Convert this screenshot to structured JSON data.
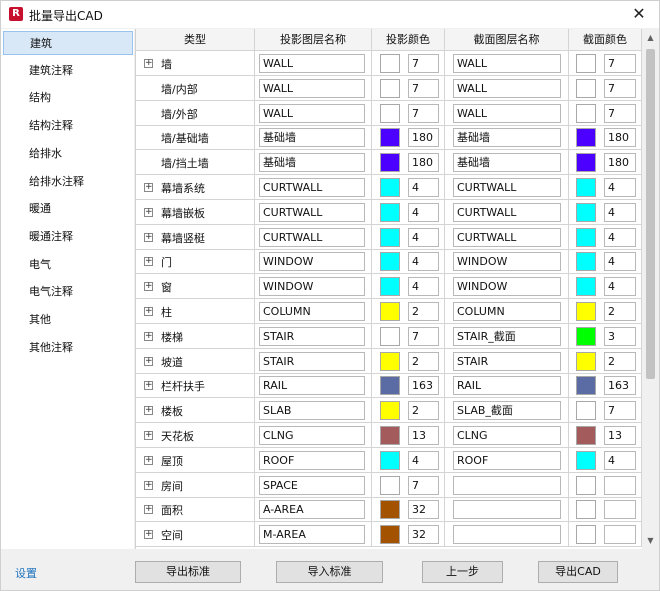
{
  "window": {
    "title": "批量导出CAD",
    "app_icon": "R",
    "close": "✕"
  },
  "sidebar": {
    "items": [
      "建筑",
      "建筑注释",
      "结构",
      "结构注释",
      "给排水",
      "给排水注释",
      "暖通",
      "暖通注释",
      "电气",
      "电气注释",
      "其他",
      "其他注释"
    ],
    "selected": "建筑"
  },
  "table": {
    "headers": [
      "类型",
      "投影图层名称",
      "投影颜色",
      "截面图层名称",
      "截面颜色"
    ],
    "rows": [
      {
        "type": "墙",
        "expandable": true,
        "proj_layer": "WALL",
        "proj_color": "#ffffff",
        "proj_num": "7",
        "cut_layer": "WALL",
        "cut_color": "#ffffff",
        "cut_num": "7"
      },
      {
        "type": "墙/内部",
        "expandable": false,
        "proj_layer": "WALL",
        "proj_color": "#ffffff",
        "proj_num": "7",
        "cut_layer": "WALL",
        "cut_color": "#ffffff",
        "cut_num": "7"
      },
      {
        "type": "墙/外部",
        "expandable": false,
        "proj_layer": "WALL",
        "proj_color": "#ffffff",
        "proj_num": "7",
        "cut_layer": "WALL",
        "cut_color": "#ffffff",
        "cut_num": "7"
      },
      {
        "type": "墙/基础墙",
        "expandable": false,
        "proj_layer": "基础墙",
        "proj_color": "#4c00ff",
        "proj_num": "180",
        "cut_layer": "基础墙",
        "cut_color": "#4c00ff",
        "cut_num": "180"
      },
      {
        "type": "墙/挡土墙",
        "expandable": false,
        "proj_layer": "基础墙",
        "proj_color": "#4c00ff",
        "proj_num": "180",
        "cut_layer": "基础墙",
        "cut_color": "#4c00ff",
        "cut_num": "180"
      },
      {
        "type": "幕墙系统",
        "expandable": true,
        "proj_layer": "CURTWALL",
        "proj_color": "#00ffff",
        "proj_num": "4",
        "cut_layer": "CURTWALL",
        "cut_color": "#00ffff",
        "cut_num": "4"
      },
      {
        "type": "幕墙嵌板",
        "expandable": true,
        "proj_layer": "CURTWALL",
        "proj_color": "#00ffff",
        "proj_num": "4",
        "cut_layer": "CURTWALL",
        "cut_color": "#00ffff",
        "cut_num": "4"
      },
      {
        "type": "幕墙竖梃",
        "expandable": true,
        "proj_layer": "CURTWALL",
        "proj_color": "#00ffff",
        "proj_num": "4",
        "cut_layer": "CURTWALL",
        "cut_color": "#00ffff",
        "cut_num": "4"
      },
      {
        "type": "门",
        "expandable": true,
        "proj_layer": "WINDOW",
        "proj_color": "#00ffff",
        "proj_num": "4",
        "cut_layer": "WINDOW",
        "cut_color": "#00ffff",
        "cut_num": "4"
      },
      {
        "type": "窗",
        "expandable": true,
        "proj_layer": "WINDOW",
        "proj_color": "#00ffff",
        "proj_num": "4",
        "cut_layer": "WINDOW",
        "cut_color": "#00ffff",
        "cut_num": "4"
      },
      {
        "type": "柱",
        "expandable": true,
        "proj_layer": "COLUMN",
        "proj_color": "#ffff00",
        "proj_num": "2",
        "cut_layer": "COLUMN",
        "cut_color": "#ffff00",
        "cut_num": "2"
      },
      {
        "type": "楼梯",
        "expandable": true,
        "proj_layer": "STAIR",
        "proj_color": "#ffffff",
        "proj_num": "7",
        "cut_layer": "STAIR_截面",
        "cut_color": "#00ff00",
        "cut_num": "3"
      },
      {
        "type": "坡道",
        "expandable": true,
        "proj_layer": "STAIR",
        "proj_color": "#ffff00",
        "proj_num": "2",
        "cut_layer": "STAIR",
        "cut_color": "#ffff00",
        "cut_num": "2"
      },
      {
        "type": "栏杆扶手",
        "expandable": true,
        "proj_layer": "RAIL",
        "proj_color": "#5b6ba3",
        "proj_num": "163",
        "cut_layer": "RAIL",
        "cut_color": "#5b6ba3",
        "cut_num": "163"
      },
      {
        "type": "楼板",
        "expandable": true,
        "proj_layer": "SLAB",
        "proj_color": "#ffff00",
        "proj_num": "2",
        "cut_layer": "SLAB_截面",
        "cut_color": "#ffffff",
        "cut_num": "7"
      },
      {
        "type": "天花板",
        "expandable": true,
        "proj_layer": "CLNG",
        "proj_color": "#a35b5b",
        "proj_num": "13",
        "cut_layer": "CLNG",
        "cut_color": "#a35b5b",
        "cut_num": "13"
      },
      {
        "type": "屋顶",
        "expandable": true,
        "proj_layer": "ROOF",
        "proj_color": "#00ffff",
        "proj_num": "4",
        "cut_layer": "ROOF",
        "cut_color": "#00ffff",
        "cut_num": "4"
      },
      {
        "type": "房间",
        "expandable": true,
        "proj_layer": "SPACE",
        "proj_color": "#ffffff",
        "proj_num": "7",
        "cut_layer": "",
        "cut_color": "#ffffff",
        "cut_num": ""
      },
      {
        "type": "面积",
        "expandable": true,
        "proj_layer": "A-AREA",
        "proj_color": "#a35200",
        "proj_num": "32",
        "cut_layer": "",
        "cut_color": "#ffffff",
        "cut_num": ""
      },
      {
        "type": "空间",
        "expandable": true,
        "proj_layer": "M-AREA",
        "proj_color": "#a35200",
        "proj_num": "32",
        "cut_layer": "",
        "cut_color": "#ffffff",
        "cut_num": ""
      }
    ]
  },
  "footer": {
    "settings_link": "设置",
    "export_standard": "导出标准",
    "import_standard": "导入标准",
    "previous": "上一步",
    "export_cad": "导出CAD"
  }
}
